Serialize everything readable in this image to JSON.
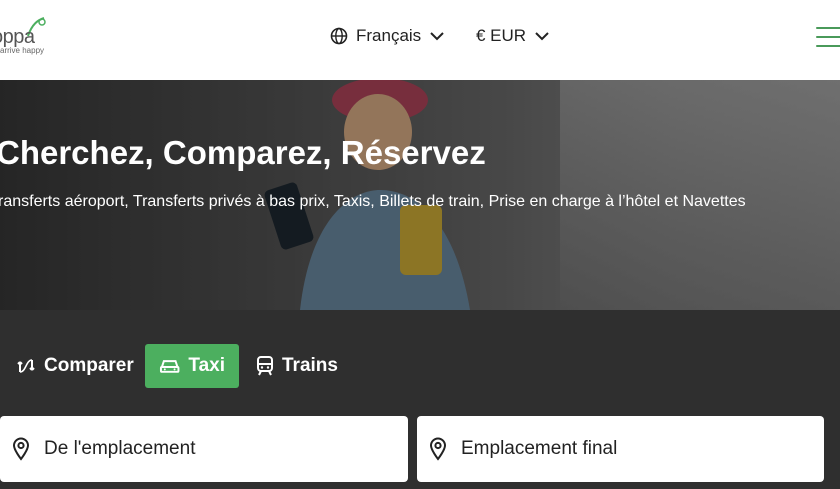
{
  "header": {
    "logo_word": "oppa",
    "logo_tagline": "arrive happy",
    "language_label": "Français",
    "currency_label": "€ EUR",
    "brand_color": "#4caf5f"
  },
  "hero": {
    "title": "Cherchez, Comparez, Réservez",
    "subtitle": "ransferts aéroport, Transferts privés à bas prix, Taxis, Billets de train, Prise en charge à l’hôtel et Navettes"
  },
  "search": {
    "tabs": [
      {
        "label": "Comparer",
        "icon": "compare-arrows-icon",
        "active": false
      },
      {
        "label": "Taxi",
        "icon": "car-icon",
        "active": true
      },
      {
        "label": "Trains",
        "icon": "train-icon",
        "active": false
      }
    ],
    "from_placeholder": "De l'emplacement",
    "to_placeholder": "Emplacement final"
  }
}
